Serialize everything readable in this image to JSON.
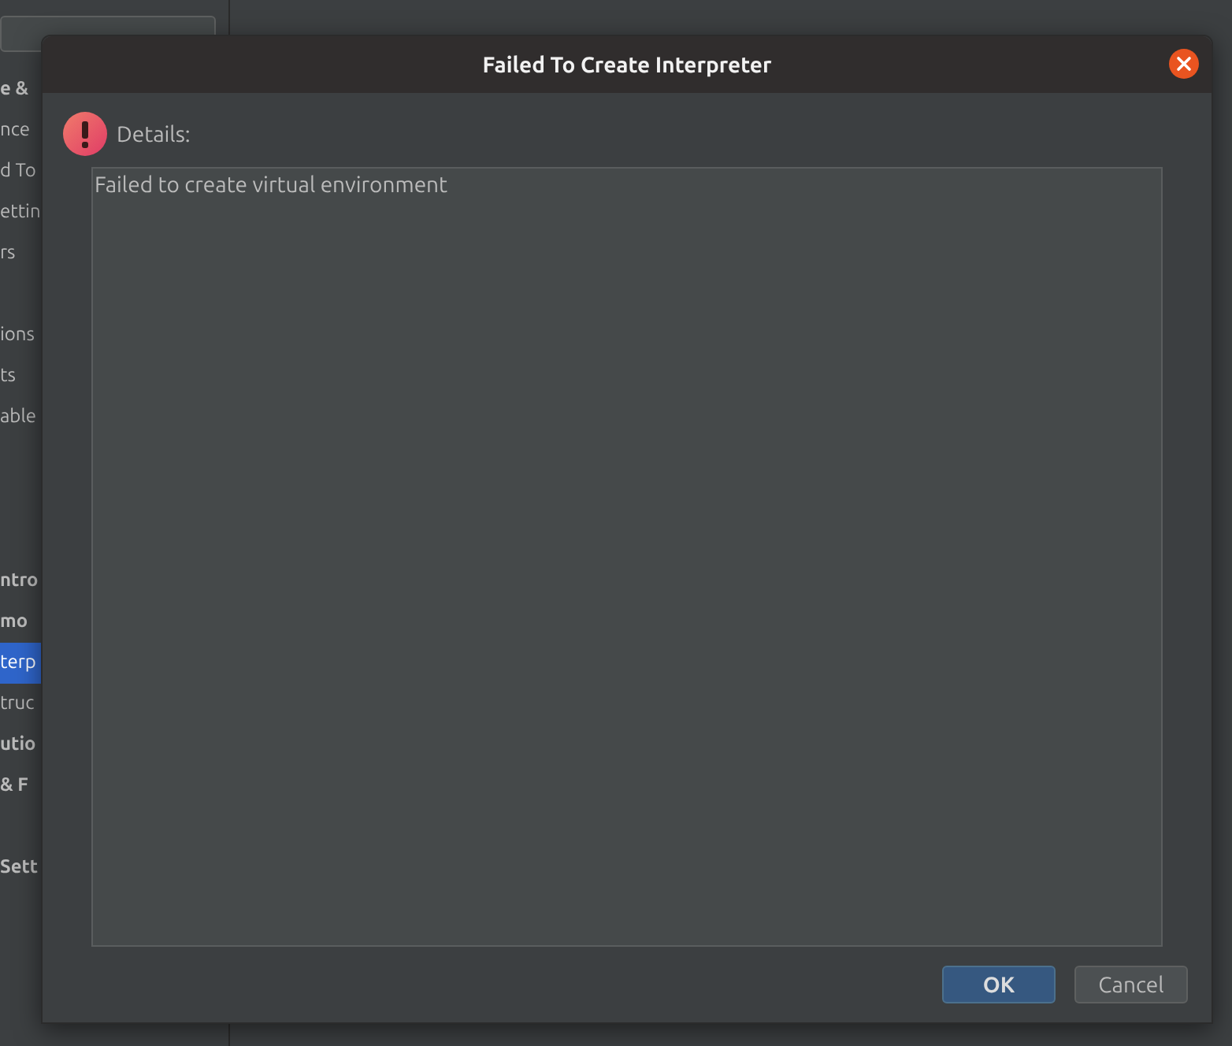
{
  "sidebar": {
    "items": [
      {
        "label": "e &",
        "bold": true,
        "selected": false
      },
      {
        "label": "nce",
        "bold": false,
        "selected": false
      },
      {
        "label": "d To",
        "bold": false,
        "selected": false
      },
      {
        "label": "ettin",
        "bold": false,
        "selected": false
      },
      {
        "label": "rs",
        "bold": false,
        "selected": false
      },
      {
        "label": "ions",
        "bold": false,
        "selected": false
      },
      {
        "label": "ts",
        "bold": false,
        "selected": false
      },
      {
        "label": "able",
        "bold": false,
        "selected": false
      },
      {
        "label": "ntro",
        "bold": true,
        "selected": false
      },
      {
        "label": "mo",
        "bold": true,
        "selected": false
      },
      {
        "label": "terp",
        "bold": false,
        "selected": true
      },
      {
        "label": "truc",
        "bold": false,
        "selected": false
      },
      {
        "label": "utio",
        "bold": true,
        "selected": false
      },
      {
        "label": "& F",
        "bold": true,
        "selected": false
      },
      {
        "label": "Sett",
        "bold": true,
        "selected": false
      }
    ]
  },
  "dialog": {
    "title": "Failed To Create Interpreter",
    "details_label": "Details:",
    "details_text": "Failed to create virtual environment",
    "buttons": [
      {
        "label": "OK",
        "default": true
      },
      {
        "label": "Cancel",
        "default": false
      }
    ]
  }
}
